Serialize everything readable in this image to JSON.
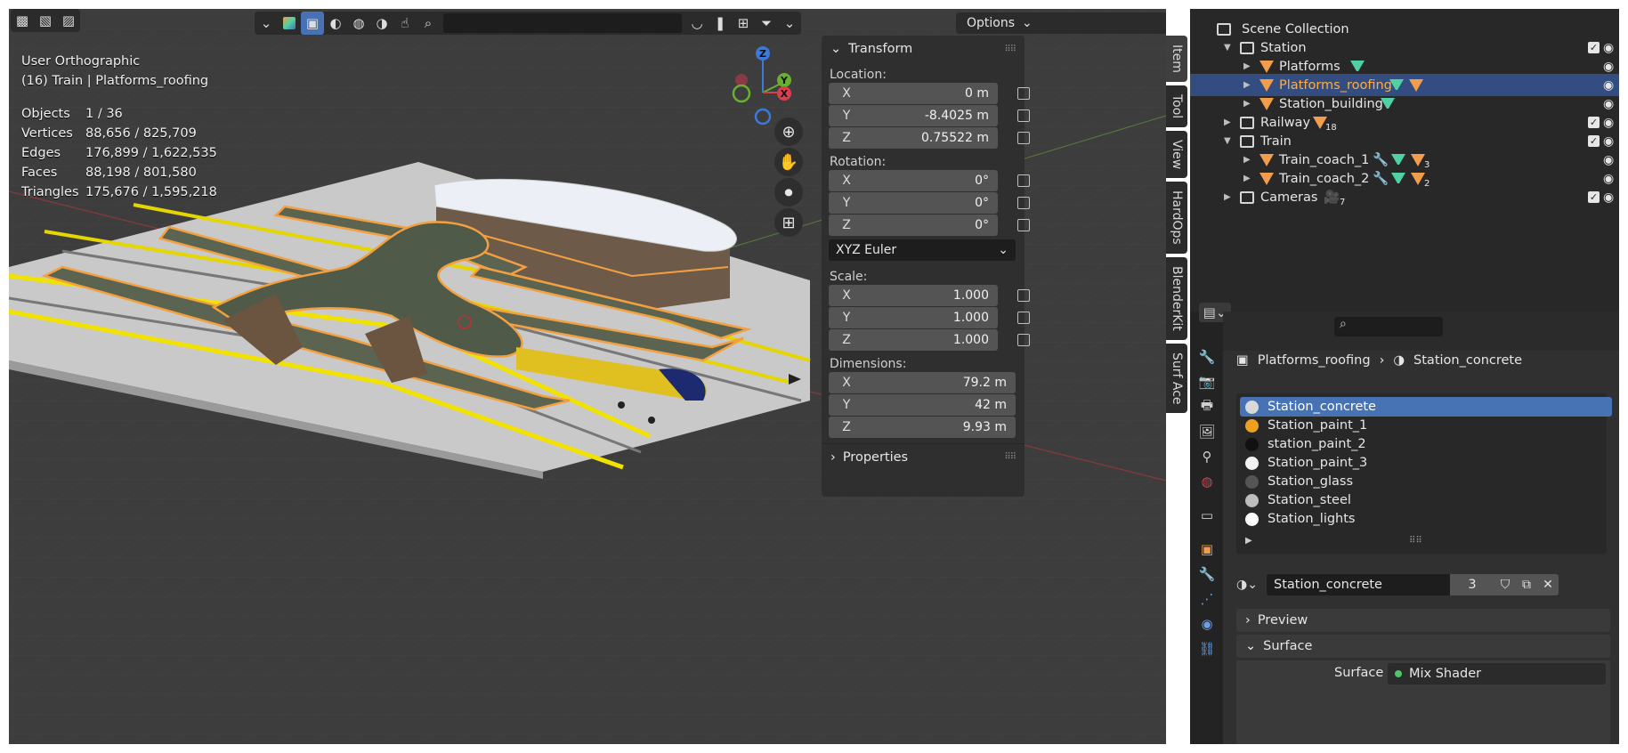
{
  "viewport": {
    "view_name": "User Orthographic",
    "context": "(16) Train | Platforms_roofing",
    "options_label": "Options",
    "stats": [
      {
        "label": "Objects",
        "value": "1 / 36"
      },
      {
        "label": "Vertices",
        "value": "88,656 / 825,709"
      },
      {
        "label": "Edges",
        "value": "176,899 / 1,622,535"
      },
      {
        "label": "Faces",
        "value": "88,198 / 801,580"
      },
      {
        "label": "Triangles",
        "value": "175,676 / 1,595,218"
      }
    ],
    "gizmo_axes": {
      "z": "Z",
      "y": "Y",
      "x": "X"
    }
  },
  "npanel": {
    "transform_header": "Transform",
    "location_label": "Location:",
    "location": [
      {
        "axis": "X",
        "value": "0 m"
      },
      {
        "axis": "Y",
        "value": "-8.4025 m"
      },
      {
        "axis": "Z",
        "value": "0.75522 m"
      }
    ],
    "rotation_label": "Rotation:",
    "rotation": [
      {
        "axis": "X",
        "value": "0°"
      },
      {
        "axis": "Y",
        "value": "0°"
      },
      {
        "axis": "Z",
        "value": "0°"
      }
    ],
    "rotation_mode": "XYZ Euler",
    "scale_label": "Scale:",
    "scale": [
      {
        "axis": "X",
        "value": "1.000"
      },
      {
        "axis": "Y",
        "value": "1.000"
      },
      {
        "axis": "Z",
        "value": "1.000"
      }
    ],
    "dimensions_label": "Dimensions:",
    "dimensions": [
      {
        "axis": "X",
        "value": "79.2 m"
      },
      {
        "axis": "Y",
        "value": "42 m"
      },
      {
        "axis": "Z",
        "value": "9.93 m"
      }
    ],
    "properties_header": "Properties"
  },
  "vertical_tabs": [
    "Item",
    "Tool",
    "View",
    "HardOps",
    "BlenderKit",
    "Surf Ace"
  ],
  "outliner": {
    "root": "Scene Collection",
    "rows": [
      {
        "label": "Station",
        "badge": ""
      },
      {
        "label": "Platforms",
        "badge": ""
      },
      {
        "label": "Platforms_roofing",
        "badge": ""
      },
      {
        "label": "Station_building",
        "badge": ""
      },
      {
        "label": "Railway",
        "badge": "18"
      },
      {
        "label": "Train",
        "badge": ""
      },
      {
        "label": "Train_coach_1",
        "badge": "3"
      },
      {
        "label": "Train_coach_2",
        "badge": "2"
      },
      {
        "label": "Cameras",
        "badge": "7"
      }
    ]
  },
  "properties": {
    "breadcrumb_object": "Platforms_roofing",
    "breadcrumb_material": "Station_concrete",
    "material_slots": [
      {
        "name": "Station_concrete",
        "color": "#d9d9d9"
      },
      {
        "name": "Station_paint_1",
        "color": "#f0a020"
      },
      {
        "name": "station_paint_2",
        "color": "#111111"
      },
      {
        "name": "Station_paint_3",
        "color": "#f2f2f2"
      },
      {
        "name": "Station_glass",
        "color": "#555555"
      },
      {
        "name": "Station_steel",
        "color": "#bdbdbd"
      },
      {
        "name": "Station_lights",
        "color": "#ffffff"
      }
    ],
    "material_name": "Station_concrete",
    "user_count": "3",
    "preview_label": "Preview",
    "surface_label": "Surface",
    "surface_field_label": "Surface",
    "surface_value": "Mix Shader"
  },
  "colors": {
    "accent": "#4772b3",
    "selected_row": "#334d80",
    "selected_text": "#ffad42",
    "object_orange": "#f29d4b",
    "mesh_green": "#4fd1a4"
  }
}
